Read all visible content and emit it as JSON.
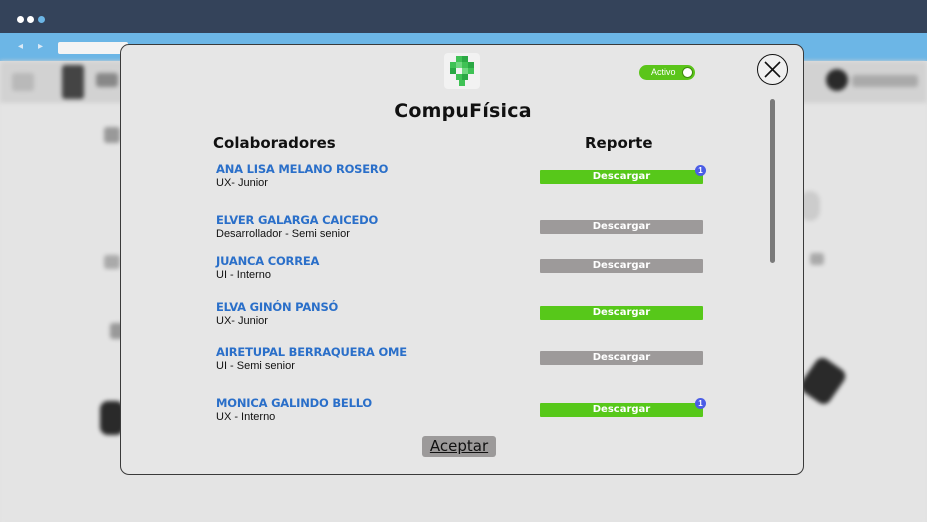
{
  "browser": {
    "back_label": "◂",
    "forward_label": "▸"
  },
  "modal": {
    "brand": "CompuFísica",
    "toggle_label": "Activo",
    "headers": {
      "collaborators": "Colaboradores",
      "report": "Reporte"
    },
    "rows": [
      {
        "name": "ANA LISA MELANO ROSERO",
        "role": "UX- Junior",
        "button": "Descargar",
        "status": "active",
        "badge": "1"
      },
      {
        "name": "ELVER GALARGA CAICEDO",
        "role": "Desarrollador - Semi senior",
        "button": "Descargar",
        "status": "inactive",
        "badge": ""
      },
      {
        "name": "JUANCA CORREA",
        "role": "UI - Interno",
        "button": "Descargar",
        "status": "inactive",
        "badge": ""
      },
      {
        "name": "ELVA GINÓN PANSÓ",
        "role": "UX- Junior",
        "button": "Descargar",
        "status": "active",
        "badge": ""
      },
      {
        "name": "AIRETUPAL BERRAQUERA OME",
        "role": "UI - Semi senior",
        "button": "Descargar",
        "status": "inactive",
        "badge": ""
      },
      {
        "name": "MONICA GALINDO BELLO",
        "role": "UX - Interno",
        "button": "Descargar",
        "status": "active",
        "badge": "1"
      }
    ],
    "accept_label": "Aceptar"
  },
  "colors": {
    "titlebar": "#34435a",
    "urlbar": "#6cb6e6",
    "active": "#57c81a",
    "inactive": "#9d9a9a",
    "name_link": "#2a6fc9",
    "badge": "#4b5de6"
  }
}
